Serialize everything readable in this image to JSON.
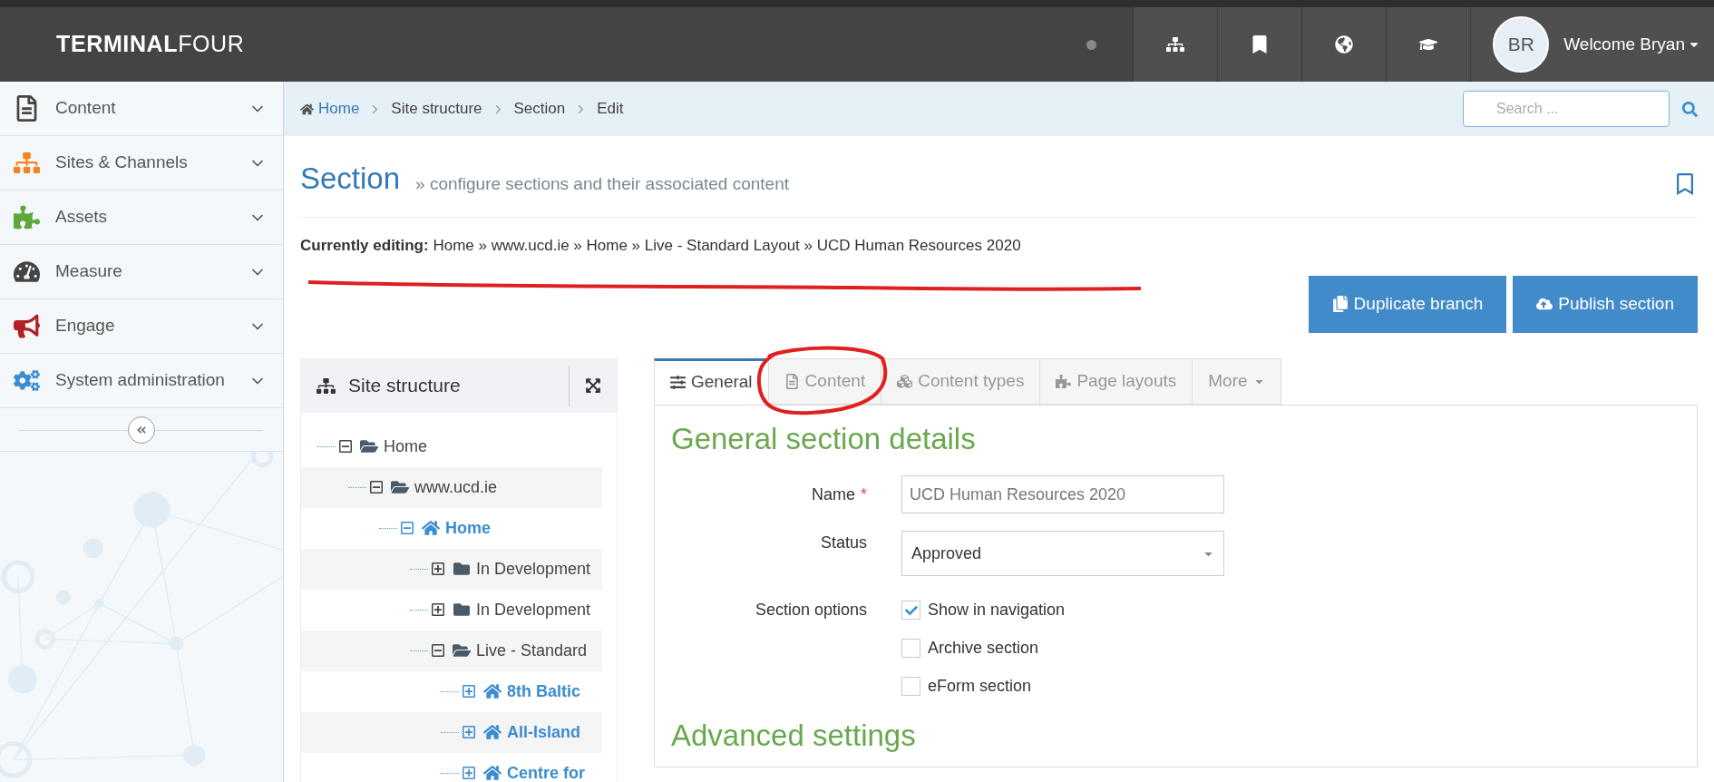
{
  "topbar": {
    "logo_bold": "TERMINAL",
    "logo_light": "FOUR",
    "icons": [
      {
        "kind": "sitemap"
      },
      {
        "kind": "bookmark"
      },
      {
        "kind": "globe"
      },
      {
        "kind": "graduation"
      }
    ],
    "avatar": "BR",
    "user_menu": "Welcome Bryan"
  },
  "sidebar": {
    "items": [
      {
        "kind": "content",
        "label": "Content"
      },
      {
        "kind": "sites",
        "label": "Sites & Channels"
      },
      {
        "kind": "assets",
        "label": "Assets"
      },
      {
        "kind": "measure",
        "label": "Measure"
      },
      {
        "kind": "engage",
        "label": "Engage"
      },
      {
        "kind": "system",
        "label": "System administration"
      }
    ]
  },
  "breadcrumb": [
    {
      "label": "Home",
      "link": true
    },
    {
      "label": "Site structure",
      "link": false
    },
    {
      "label": "Section",
      "link": false
    },
    {
      "label": "Edit",
      "link": false
    }
  ],
  "search": {
    "placeholder": "Search ..."
  },
  "page": {
    "title": "Section",
    "subtitle": "» configure sections and their associated content",
    "currently_editing": "**Currently editing:** Home » www.ucd.ie » Home » Live - Standard Layout » UCD Human Resources 2020"
  },
  "actions": [
    {
      "kind": "duplicate",
      "label": "Duplicate branch"
    },
    {
      "kind": "publish",
      "label": "Publish section"
    }
  ],
  "site_structure": {
    "title": "Site structure",
    "tree": [
      {
        "label": "Home",
        "kind": "folder",
        "expanded": true,
        "children": [
          {
            "label": "www.ucd.ie",
            "kind": "folder",
            "expanded": true,
            "children": [
              {
                "label": "Home",
                "kind": "home",
                "expanded": true,
                "children": [
                  {
                    "label": "In Development",
                    "kind": "folder",
                    "expanded": false
                  },
                  {
                    "label": "In Development",
                    "kind": "folder",
                    "expanded": false
                  },
                  {
                    "label": "Live - Standard",
                    "kind": "folder",
                    "expanded": true,
                    "children": [
                      {
                        "label": "8th Baltic",
                        "kind": "home",
                        "expanded": false
                      },
                      {
                        "label": "All-Island",
                        "kind": "home",
                        "expanded": false
                      },
                      {
                        "label": "Centre for",
                        "kind": "home",
                        "expanded": false
                      }
                    ]
                  }
                ]
              }
            ]
          }
        ]
      }
    ]
  },
  "tabs": [
    {
      "kind": "general",
      "label": "General",
      "selected": true
    },
    {
      "kind": "content",
      "label": "Content",
      "selected": false
    },
    {
      "kind": "types",
      "label": "Content types",
      "selected": false
    },
    {
      "kind": "layouts",
      "label": "Page layouts",
      "selected": false
    },
    {
      "kind": "more",
      "label": "More",
      "selected": false
    }
  ],
  "form": {
    "heading": "General section details",
    "name": {
      "label": "Name",
      "required_mark": "*",
      "value": "UCD Human Resources 2020"
    },
    "status": {
      "label": "Status",
      "value": "Approved"
    },
    "options": {
      "label": "Section options",
      "items": [
        {
          "label": "Show in navigation",
          "checked": true
        },
        {
          "label": "Archive section",
          "checked": false
        },
        {
          "label": "eForm section",
          "checked": false
        }
      ]
    },
    "advanced_heading": "Advanced settings"
  }
}
